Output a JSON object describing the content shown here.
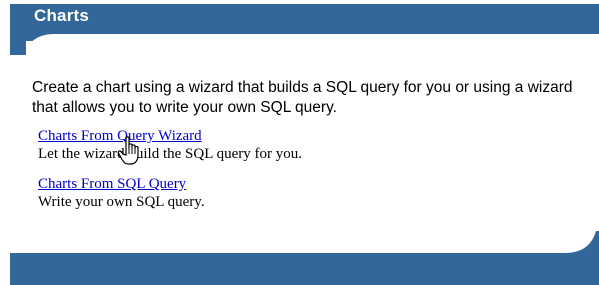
{
  "header": {
    "title": "Charts"
  },
  "intro_text": "Create a chart using a wizard that builds a SQL query for you or using a wizard that allows you to write your own SQL query.",
  "options": [
    {
      "link_label": "Charts From Query Wizard",
      "description": "Let the wizard build the SQL query for you."
    },
    {
      "link_label": "Charts From SQL Query",
      "description": "Write your own SQL query."
    }
  ],
  "colors": {
    "region_band": "#336699",
    "link": "#0000cc",
    "text": "#000000"
  },
  "icons": {
    "cursor": "hand-pointer-icon"
  }
}
